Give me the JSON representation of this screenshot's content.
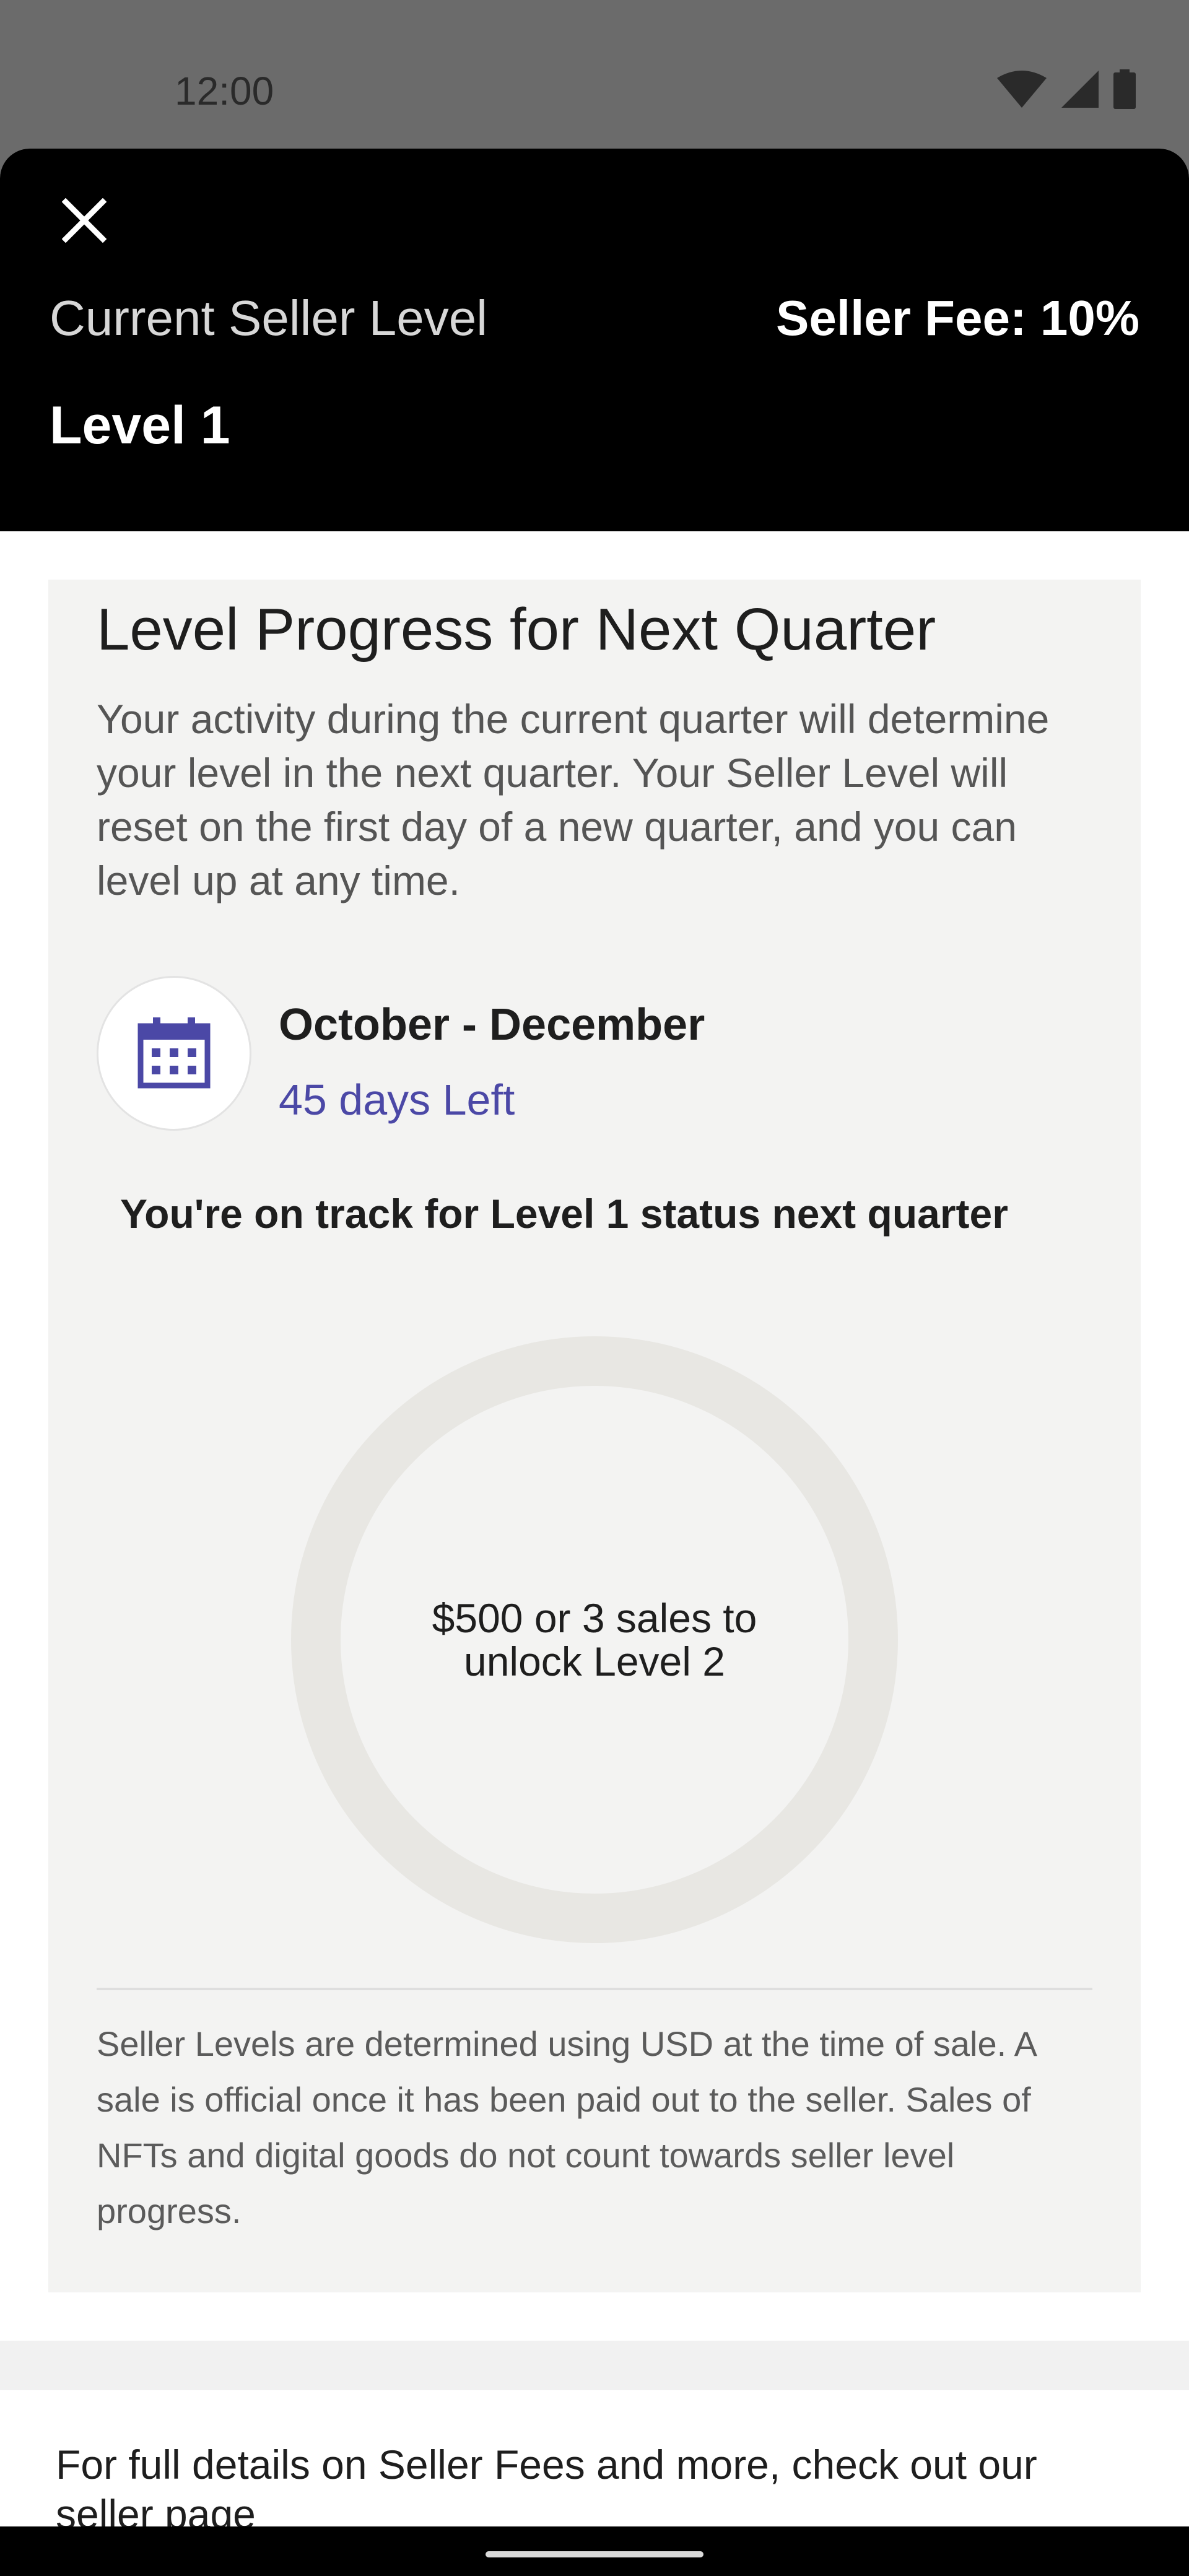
{
  "status_bar": {
    "time": "12:00"
  },
  "header": {
    "current_level_label": "Current Seller Level",
    "seller_fee": "Seller Fee: 10%",
    "level_name": "Level 1"
  },
  "progress_card": {
    "title": "Level Progress for Next Quarter",
    "description": "Your activity during the current quarter will determine your level in the next quarter. Your Seller Level will reset on the first day of a new quarter, and you can level up at any time.",
    "period": "October - December",
    "days_left": "45 days Left",
    "track_status": "You're on track for Level 1 status next quarter",
    "ring_text": "$500 or 3 sales to unlock Level 2",
    "progress_fraction": 0,
    "footnote": "Seller Levels are determined using USD at the time of sale. A sale is official once it has been paid out to the seller. Sales of NFTs and digital goods do not count towards seller level progress."
  },
  "details": {
    "text": "For full details on Seller Fees and more, check out our seller page"
  },
  "colors": {
    "header_bg": "#000000",
    "card_bg": "#f3f3f2",
    "ring_track": "#e8e7e3",
    "accent_purple": "#4b48a6"
  },
  "icons": {
    "close": "close-icon",
    "calendar": "calendar-icon",
    "wifi": "wifi-icon",
    "signal": "signal-icon",
    "battery": "battery-icon"
  }
}
